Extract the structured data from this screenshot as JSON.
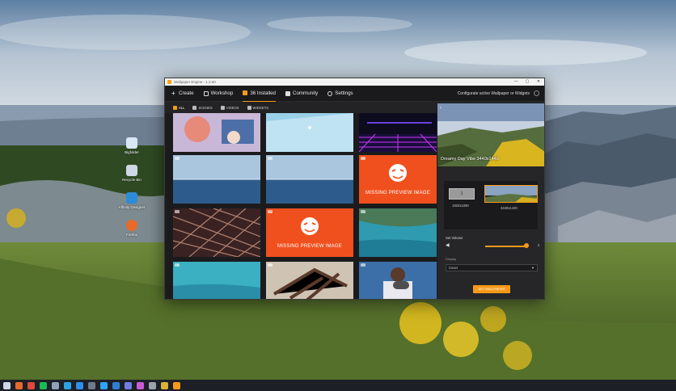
{
  "window": {
    "title": "Wallpaper Engine - 1.2.60",
    "controls": [
      "—",
      "▢",
      "✕"
    ]
  },
  "nav": {
    "items": [
      {
        "label": "Create",
        "icon": "plus-icon"
      },
      {
        "label": "Workshop",
        "icon": "workshop-icon"
      },
      {
        "label": "36 Installed",
        "icon": "installed-icon"
      },
      {
        "label": "Community",
        "icon": "community-icon"
      },
      {
        "label": "Settings",
        "icon": "gear-icon"
      }
    ],
    "active_index": 2,
    "configure_label": "Configurate active Wallpaper or Widgets"
  },
  "subnav": {
    "items": [
      "ALL",
      "SCENES",
      "VIDEOS",
      "WIDGETS"
    ],
    "active_index": 0
  },
  "grid": {
    "tiles": [
      {
        "kind": "anime"
      },
      {
        "kind": "sky"
      },
      {
        "kind": "synthwave"
      },
      {
        "kind": "ocean"
      },
      {
        "kind": "ocean"
      },
      {
        "kind": "missing",
        "text": "MISSING PREVIEW IMAGE"
      },
      {
        "kind": "grid-dark"
      },
      {
        "kind": "missing",
        "text": "MISSING PREVIEW IMAGE"
      },
      {
        "kind": "lagoon"
      },
      {
        "kind": "beach"
      },
      {
        "kind": "driftwood"
      },
      {
        "kind": "video"
      }
    ]
  },
  "panel": {
    "preview_title": "Dreamy Day Vibe 3440x1440",
    "monitors": [
      {
        "number": "1",
        "resolution": "1920x1080"
      },
      {
        "number": "2",
        "resolution": "3440x1440"
      }
    ],
    "volume_label": "Set Volume",
    "volume_value": "2",
    "volume_level": 0.95,
    "display_label": "Display",
    "display_value": "Cover",
    "set_button": "SET WALLPAPER"
  },
  "desktop_icons": [
    {
      "label": "Bigfolder",
      "color": "#d9e6f5"
    },
    {
      "label": "Recycle Bin",
      "color": "#cfd8e6"
    },
    {
      "label": "Affinity Designer",
      "color": "#2e8bd8"
    },
    {
      "label": "Firefox",
      "color": "#e86a2a"
    }
  ],
  "taskbar": {
    "icons": [
      {
        "name": "windows-start-icon",
        "color": "#cfd8e6"
      },
      {
        "name": "firefox-icon",
        "color": "#e86a2a"
      },
      {
        "name": "chrome-icon",
        "color": "#e04a3a"
      },
      {
        "name": "spotify-icon",
        "color": "#1db954"
      },
      {
        "name": "steam-icon",
        "color": "#8fa3b8"
      },
      {
        "name": "telegram-icon",
        "color": "#2aa3e0"
      },
      {
        "name": "vscode-icon",
        "color": "#2f8fe6"
      },
      {
        "name": "terminal-icon",
        "color": "#6f7b8a"
      },
      {
        "name": "photoshop-icon",
        "color": "#2fa3ff"
      },
      {
        "name": "outlook-icon",
        "color": "#2f7fd0"
      },
      {
        "name": "discord-icon",
        "color": "#6f7fe0"
      },
      {
        "name": "affinity-icon",
        "color": "#c85ad8"
      },
      {
        "name": "tool-icon",
        "color": "#9aa1ad"
      },
      {
        "name": "game-icon",
        "color": "#d8b23a"
      },
      {
        "name": "wallpaper-engine-icon",
        "color": "#f79a1a"
      }
    ]
  },
  "colors": {
    "accent": "#f79a1a",
    "missing_tile": "#f0501e"
  }
}
